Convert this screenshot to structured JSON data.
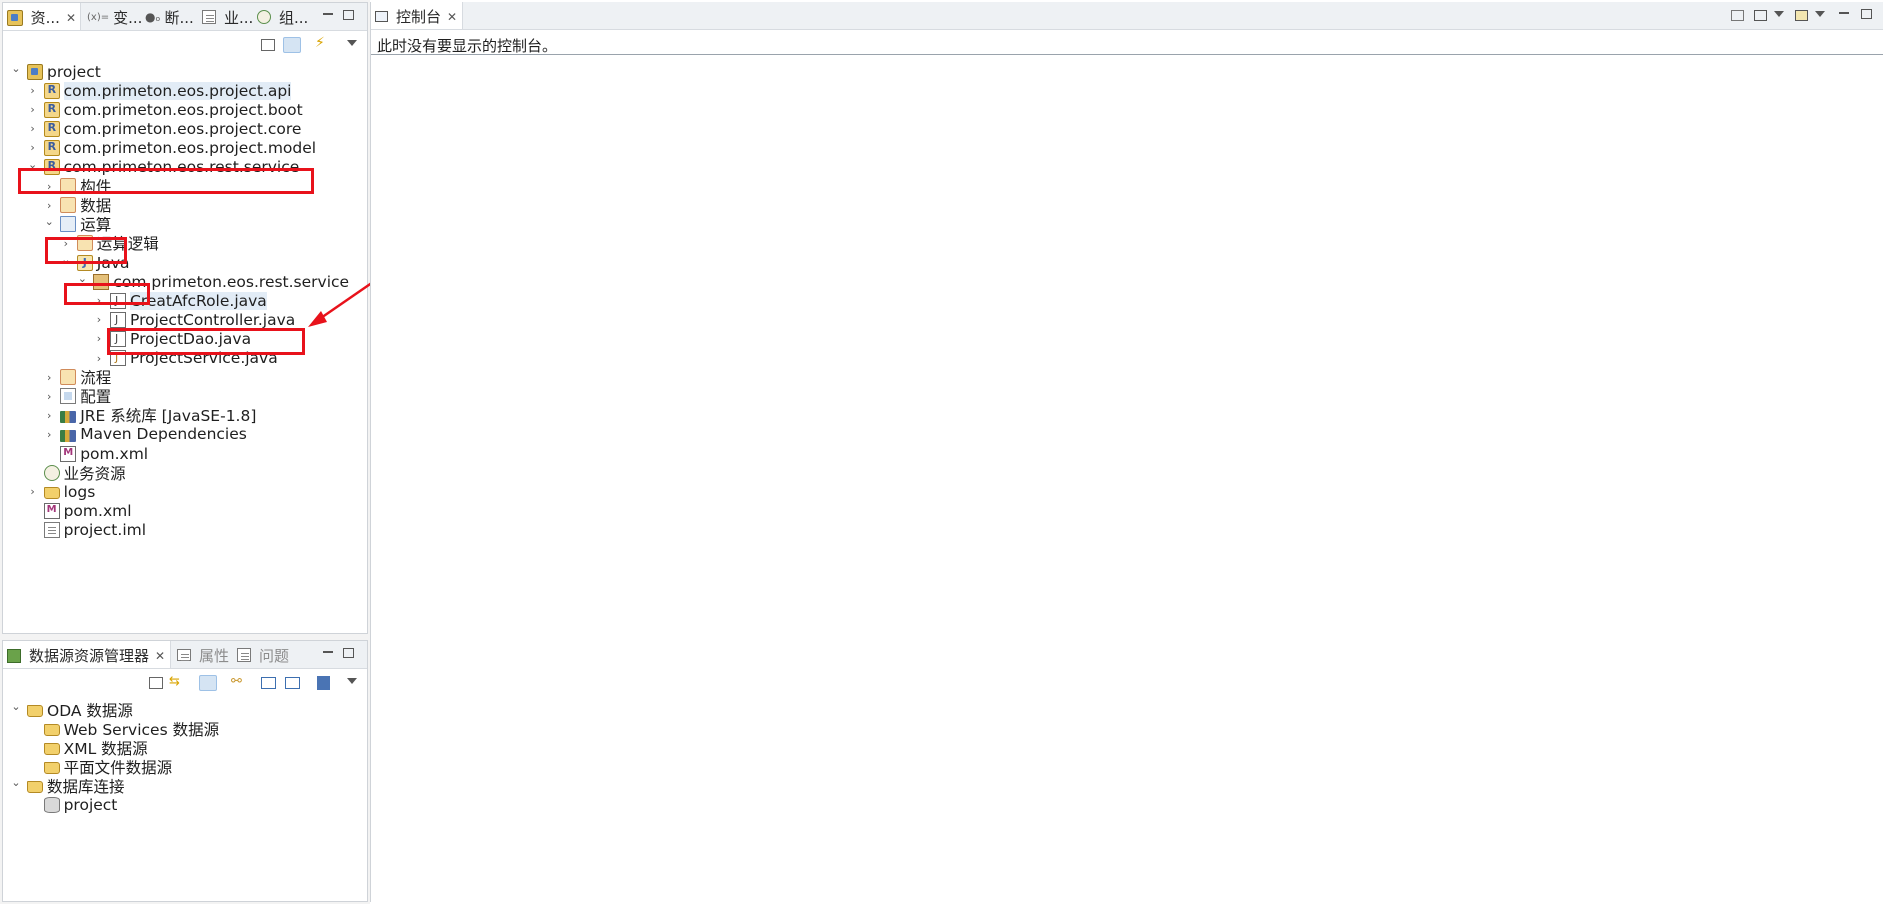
{
  "top_panel": {
    "tabs": [
      {
        "label": "资...",
        "icon": "resources-icon",
        "active": true,
        "close": "✕"
      },
      {
        "label": "变...",
        "icon": "variables-icon",
        "active": false
      },
      {
        "label": "断...",
        "icon": "breakpoints-icon",
        "active": false
      },
      {
        "label": "业...",
        "icon": "business-icon",
        "active": false
      },
      {
        "label": "组...",
        "icon": "components-icon",
        "active": false
      }
    ],
    "tree": [
      {
        "label": "project",
        "level": 0,
        "twisty": "expanded",
        "icon": "project-icon"
      },
      {
        "label": "com.primeton.eos.project.api",
        "level": 1,
        "twisty": "collapsed",
        "icon": "module-icon",
        "highlight": true
      },
      {
        "label": "com.primeton.eos.project.boot",
        "level": 1,
        "twisty": "collapsed",
        "icon": "module-icon"
      },
      {
        "label": "com.primeton.eos.project.core",
        "level": 1,
        "twisty": "collapsed",
        "icon": "module-icon"
      },
      {
        "label": "com.primeton.eos.project.model",
        "level": 1,
        "twisty": "collapsed",
        "icon": "module-icon"
      },
      {
        "label": "com.primeton.eos.rest.service",
        "level": 1,
        "twisty": "expanded",
        "icon": "module-icon"
      },
      {
        "label": "构件",
        "level": 2,
        "twisty": "collapsed",
        "icon": "component-folder-icon"
      },
      {
        "label": "数据",
        "level": 2,
        "twisty": "collapsed",
        "icon": "data-folder-icon"
      },
      {
        "label": "运算",
        "level": 2,
        "twisty": "expanded",
        "icon": "operation-icon"
      },
      {
        "label": "运算逻辑",
        "level": 3,
        "twisty": "collapsed",
        "icon": "logic-folder-icon"
      },
      {
        "label": "Java",
        "level": 3,
        "twisty": "expanded",
        "icon": "java-source-icon"
      },
      {
        "label": "com.primeton.eos.rest.service",
        "level": 4,
        "twisty": "expanded",
        "icon": "package-icon"
      },
      {
        "label": "CreatAfcRole.java",
        "level": 5,
        "twisty": "collapsed",
        "icon": "java-file-icon",
        "highlight": true
      },
      {
        "label": "ProjectController.java",
        "level": 5,
        "twisty": "collapsed",
        "icon": "java-file-icon"
      },
      {
        "label": "ProjectDao.java",
        "level": 5,
        "twisty": "collapsed",
        "icon": "java-file-icon"
      },
      {
        "label": "ProjectService.java",
        "level": 5,
        "twisty": "collapsed",
        "icon": "java-service-icon"
      },
      {
        "label": "流程",
        "level": 2,
        "twisty": "collapsed",
        "icon": "process-folder-icon"
      },
      {
        "label": "配置",
        "level": 2,
        "twisty": "collapsed",
        "icon": "config-icon"
      },
      {
        "label": "JRE 系统库 [JavaSE-1.8]",
        "level": 2,
        "twisty": "collapsed",
        "icon": "library-icon"
      },
      {
        "label": "Maven Dependencies",
        "level": 2,
        "twisty": "collapsed",
        "icon": "library-icon"
      },
      {
        "label": "pom.xml",
        "level": 2,
        "twisty": "none",
        "icon": "pom-icon"
      },
      {
        "label": "业务资源",
        "level": 1,
        "twisty": "none",
        "icon": "business-resource-icon"
      },
      {
        "label": "logs",
        "level": 1,
        "twisty": "collapsed",
        "icon": "folder-icon"
      },
      {
        "label": "pom.xml",
        "level": 1,
        "twisty": "none",
        "icon": "pom-icon"
      },
      {
        "label": "project.iml",
        "level": 1,
        "twisty": "none",
        "icon": "file-icon"
      }
    ]
  },
  "bottom_panel": {
    "tabs": [
      {
        "label": "数据源资源管理器",
        "icon": "datasource-explorer-icon",
        "active": true,
        "close": "✕"
      },
      {
        "label": "属性",
        "icon": "properties-icon",
        "active": false
      },
      {
        "label": "问题",
        "icon": "problems-icon",
        "active": false
      }
    ],
    "tree": [
      {
        "label": "ODA 数据源",
        "level": 0,
        "twisty": "expanded",
        "icon": "folder-icon"
      },
      {
        "label": "Web Services 数据源",
        "level": 1,
        "twisty": "none",
        "icon": "folder-icon"
      },
      {
        "label": "XML 数据源",
        "level": 1,
        "twisty": "none",
        "icon": "folder-icon"
      },
      {
        "label": "平面文件数据源",
        "level": 1,
        "twisty": "none",
        "icon": "folder-icon"
      },
      {
        "label": "数据库连接",
        "level": 0,
        "twisty": "expanded",
        "icon": "folder-icon"
      },
      {
        "label": "project",
        "level": 1,
        "twisty": "none",
        "icon": "database-icon"
      }
    ]
  },
  "console": {
    "tab_label": "控制台",
    "tab_close": "✕",
    "message": "此时没有要显示的控制台。"
  },
  "glyphs": {
    "expanded": "⌄",
    "collapsed": "›"
  },
  "colors": {
    "annotation": "#e8121b",
    "selection": "#e2ecf6"
  }
}
